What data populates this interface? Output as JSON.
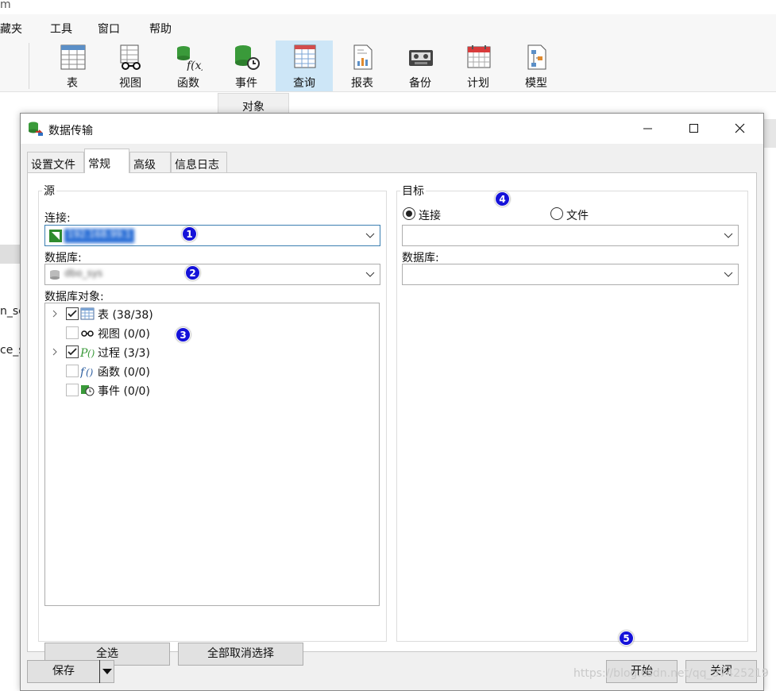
{
  "background": {
    "title_fragment": "m",
    "menu": [
      "藏夹",
      "工具",
      "窗口",
      "帮助"
    ],
    "toolbar": [
      {
        "label": "表",
        "icon": "table-icon"
      },
      {
        "label": "视图",
        "icon": "view-glasses-icon"
      },
      {
        "label": "函数",
        "icon": "function-icon"
      },
      {
        "label": "事件",
        "icon": "event-database-clock-icon"
      },
      {
        "label": "查询",
        "icon": "query-icon",
        "active": true
      },
      {
        "label": "报表",
        "icon": "report-icon"
      },
      {
        "label": "备份",
        "icon": "backup-tape-icon"
      },
      {
        "label": "计划",
        "icon": "schedule-calendar-icon"
      },
      {
        "label": "模型",
        "icon": "model-icon"
      }
    ],
    "objects_tab": "对象",
    "side_fragments": [
      "n_sc",
      "ce_s"
    ]
  },
  "dialog": {
    "title": "数据传输",
    "tabs": [
      "设置文件",
      "常规",
      "高级",
      "信息日志"
    ],
    "active_tab": "常规",
    "source": {
      "legend": "源",
      "connection_label": "连接:",
      "connection_value": "192.168.99.1",
      "database_label": "数据库:",
      "database_value": "dbo_sys",
      "objects_label": "数据库对象:",
      "objects": [
        {
          "label": "表",
          "count": "(38/38)",
          "checked": true,
          "expandable": true,
          "icon": "table-icon"
        },
        {
          "label": "视图",
          "count": "(0/0)",
          "checked": false,
          "expandable": false,
          "icon": "view-glasses-icon"
        },
        {
          "label": "过程",
          "count": "(3/3)",
          "checked": true,
          "expandable": true,
          "icon": "procedure-icon"
        },
        {
          "label": "函数",
          "count": "(0/0)",
          "checked": false,
          "expandable": false,
          "icon": "function-icon"
        },
        {
          "label": "事件",
          "count": "(0/0)",
          "checked": false,
          "expandable": false,
          "icon": "event-icon"
        }
      ],
      "select_all": "全选",
      "deselect_all": "全部取消选择"
    },
    "target": {
      "legend": "目标",
      "radio_connection": "连接",
      "radio_file": "文件",
      "selected": "连接",
      "connection_value": "",
      "database_label": "数据库:",
      "database_value": ""
    },
    "buttons": {
      "save": "保存",
      "start": "开始",
      "close": "关闭"
    },
    "markers": [
      "1",
      "2",
      "3",
      "4",
      "5"
    ]
  },
  "watermark": "https://blog.csdn.net/qq_37425219",
  "colors": {
    "accent": "#0078d7",
    "selection": "#3c7fb1",
    "marker": "#1512d9",
    "active_tool": "#cde6f7"
  }
}
